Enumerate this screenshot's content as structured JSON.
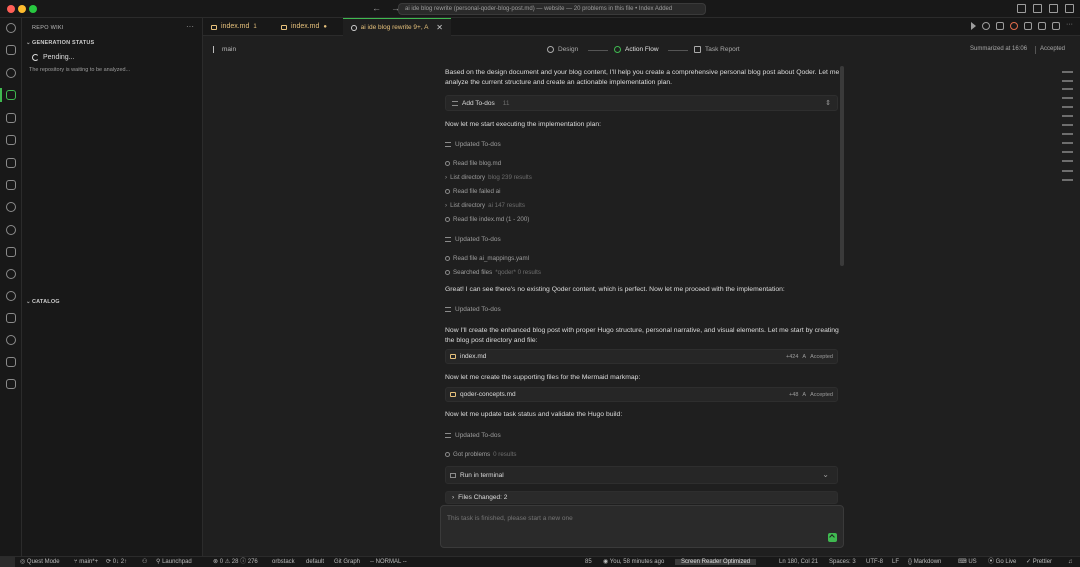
{
  "window": {
    "title": "ai ide blog rewrite (personal-qoder-blog-post.md) — website — 20 problems in this file • Index Added"
  },
  "sidebar": {
    "title": "REPO WIKI",
    "more": "···",
    "generation_status": "GENERATION STATUS",
    "pending": "Pending...",
    "waiting": "The repository is waiting to be analyzed...",
    "catalog": "CATALOG"
  },
  "tabs": [
    {
      "label": "index.md",
      "badge": "1"
    },
    {
      "label": "index.md",
      "badge": "●"
    },
    {
      "label": "ai ide blog rewrite 9+, A",
      "close": "✕"
    }
  ],
  "header": {
    "branch": "main",
    "steps": [
      "Design",
      "Action Flow",
      "Task Report"
    ],
    "summarized": "Summarized at 16:06",
    "accepted": "Accepted"
  },
  "chat": {
    "intro": "Based on the design document and your blog content, I'll help you create a comprehensive personal blog post about Qoder. Let me analyze the current structure and create an actionable implementation plan.",
    "add_todos": {
      "label": "Add To-dos",
      "count": "11"
    },
    "start_exec": "Now let me start executing the implementation plan:",
    "updated_todos": "Updated To-dos",
    "actions1": [
      {
        "label": "Read file blog.md",
        "extra": ""
      },
      {
        "label": "List directory",
        "extra": "blog 239 results"
      },
      {
        "label": "Read file failed ai",
        "extra": ""
      },
      {
        "label": "List directory",
        "extra": "ai 147 results"
      },
      {
        "label": "Read file index.md (1 - 200)",
        "extra": ""
      }
    ],
    "actions2": [
      {
        "label": "Read file ai_mappings.yaml",
        "extra": ""
      },
      {
        "label": "Searched files",
        "extra": "*qoder* 0 results"
      }
    ],
    "great": "Great! I can see there's no existing Qoder content, which is perfect. Now let me proceed with the implementation:",
    "create_post": "Now I'll create the enhanced blog post with proper Hugo structure, personal narrative, and visual elements. Let me start by creating the blog post directory and file:",
    "file1": {
      "name": "index.md",
      "plus": "+424",
      "status": "Accepted"
    },
    "supporting": "Now let me create the supporting files for the Mermaid markmap:",
    "file2": {
      "name": "qoder-concepts.md",
      "plus": "+48",
      "status": "Accepted"
    },
    "update_status": "Now let me update task status and validate the Hugo build:",
    "got_problems": {
      "label": "Got problems",
      "extra": "0 results"
    },
    "run_terminal": "Run in terminal",
    "files_changed": "Files Changed: 2",
    "input_placeholder": "This task is finished, please start a new one"
  },
  "statusbar": {
    "quest": "Quest Mode",
    "branch": "main*+",
    "sync": "0↓ 2↑",
    "launchpad": "Launchpad",
    "problems": "⊗ 0 ⚠ 28 ⓘ 276",
    "orbstack": "orbstack",
    "default": "default",
    "git_graph": "Git Graph",
    "vim_mode": "-- NORMAL --",
    "line_num": "85",
    "blame": "You, 58 minutes ago",
    "reader": "Screen Reader Optimized",
    "position": "Ln 180, Col 21",
    "spaces": "Spaces: 3",
    "encoding": "UTF-8",
    "eol": "LF",
    "language": "Markdown",
    "locale": "US",
    "golive": "Go Live",
    "prettier": "Prettier"
  }
}
